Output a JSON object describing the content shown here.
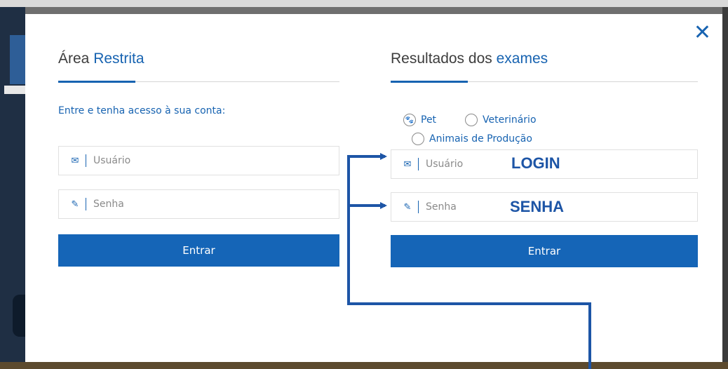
{
  "modal": {
    "close_icon": "close-icon"
  },
  "login": {
    "title_main": "Área",
    "title_accent": "Restrita",
    "intro": "Entre e tenha acesso à sua conta:",
    "user_placeholder": "Usuário",
    "user_icon": "envelope-icon",
    "pass_placeholder": "Senha",
    "pass_icon": "pencil-icon",
    "submit_label": "Entrar"
  },
  "results": {
    "title_main": "Resultados dos",
    "title_accent": "exames",
    "radio_options": [
      {
        "label": "Pet",
        "selected": true,
        "icon": "paw-icon"
      },
      {
        "label": "Veterinário",
        "selected": false
      },
      {
        "label": "Animais de Produção",
        "selected": false
      }
    ],
    "user_placeholder": "Usuário",
    "pass_placeholder": "Senha",
    "submit_label": "Entrar"
  },
  "annotations": {
    "login_label": "LOGIN",
    "senha_label": "SENHA"
  },
  "colors": {
    "accent": "#1763b1",
    "button": "#1565b7",
    "annotation": "#1d55a6"
  }
}
